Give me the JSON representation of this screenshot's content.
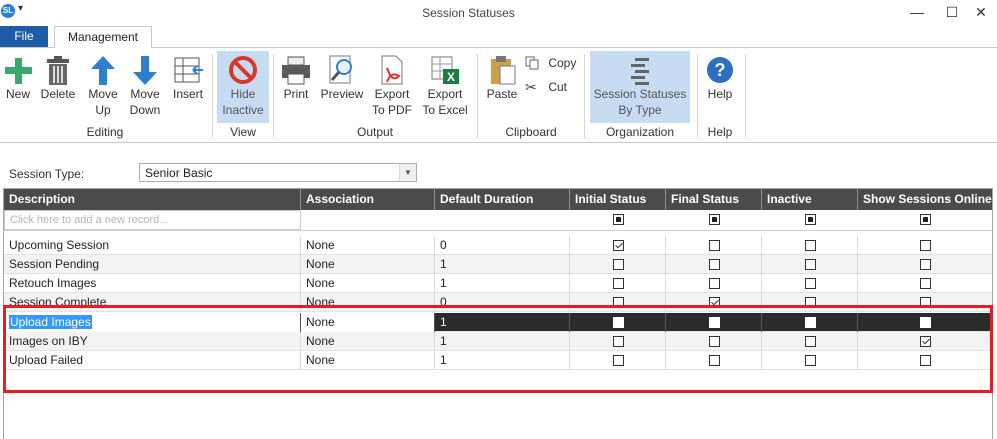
{
  "window": {
    "title": "Session Statuses",
    "app_icon": "SL"
  },
  "tabs": [
    {
      "label": "File"
    },
    {
      "label": "Management"
    }
  ],
  "ribbon": {
    "editing": {
      "label": "Editing",
      "new": "New",
      "delete": "Delete",
      "move_up_1": "Move",
      "move_up_2": "Up",
      "move_down_1": "Move",
      "move_down_2": "Down",
      "insert": "Insert"
    },
    "view": {
      "label": "View",
      "hide_inactive_1": "Hide",
      "hide_inactive_2": "Inactive"
    },
    "output": {
      "label": "Output",
      "print": "Print",
      "preview": "Preview",
      "export_pdf_1": "Export",
      "export_pdf_2": "To PDF",
      "export_excel_1": "Export",
      "export_excel_2": "To Excel"
    },
    "clipboard": {
      "label": "Clipboard",
      "paste": "Paste",
      "copy": "Copy",
      "cut": "Cut"
    },
    "organization": {
      "label": "Organization",
      "by_type_1": "Session Statuses",
      "by_type_2": "By Type"
    },
    "help": {
      "label": "Help",
      "help": "Help"
    }
  },
  "session_type": {
    "label": "Session Type:",
    "value": "Senior Basic"
  },
  "grid": {
    "columns": [
      "Description",
      "Association",
      "Default Duration",
      "Initial Status",
      "Final Status",
      "Inactive",
      "Show Sessions Online"
    ],
    "new_row_placeholder": "Click here to add a new record...",
    "rows": [
      {
        "description": "Upcoming Session",
        "association": "None",
        "duration": "0",
        "initial": true,
        "final": false,
        "inactive": false,
        "online": false
      },
      {
        "description": "Session Pending",
        "association": "None",
        "duration": "1",
        "initial": false,
        "final": false,
        "inactive": false,
        "online": false
      },
      {
        "description": "Retouch Images",
        "association": "None",
        "duration": "1",
        "initial": false,
        "final": false,
        "inactive": false,
        "online": false
      },
      {
        "description": "Session Complete",
        "association": "None",
        "duration": "0",
        "initial": false,
        "final": true,
        "inactive": false,
        "online": false
      },
      {
        "description": "Upload Images",
        "association": "None",
        "duration": "1",
        "initial": false,
        "final": false,
        "inactive": false,
        "online": false
      },
      {
        "description": "Images on IBY",
        "association": "None",
        "duration": "1",
        "initial": false,
        "final": false,
        "inactive": false,
        "online": true
      },
      {
        "description": "Upload Failed",
        "association": "None",
        "duration": "1",
        "initial": false,
        "final": false,
        "inactive": false,
        "online": false
      }
    ]
  },
  "colors": {
    "file_tab": "#1f5ca8",
    "header_bg": "#4b4b4b",
    "selected_row": "#2b2b2b",
    "highlight_border": "#e51d24",
    "active_button": "#c7dcf2"
  }
}
